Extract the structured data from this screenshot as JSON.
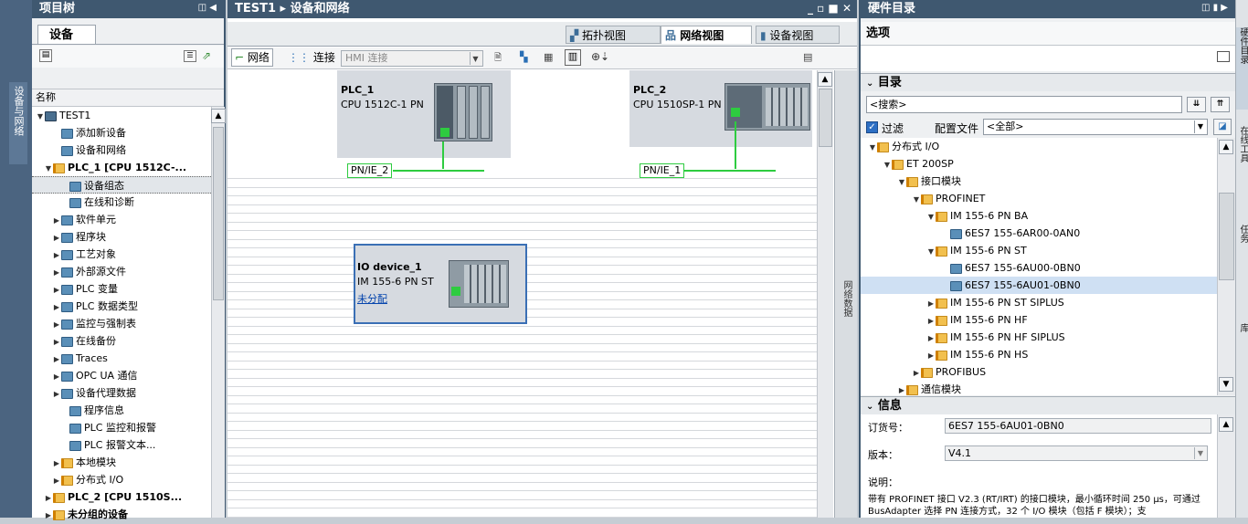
{
  "left_strip": {
    "label": "设备与网络"
  },
  "project_tree": {
    "title": "项目树",
    "tab": "设备",
    "column_header": "名称",
    "items": [
      {
        "label": "TEST1",
        "indent": 0,
        "arrow": "▼",
        "icon": "dev"
      },
      {
        "label": "添加新设备",
        "indent": 2,
        "arrow": "",
        "icon": "gicon"
      },
      {
        "label": "设备和网络",
        "indent": 2,
        "arrow": "",
        "icon": "gicon"
      },
      {
        "label": "PLC_1 [CPU 1512C-...",
        "indent": 1,
        "arrow": "▼",
        "icon": "fold"
      },
      {
        "label": "设备组态",
        "indent": 3,
        "arrow": "",
        "icon": "gicon"
      },
      {
        "label": "在线和诊断",
        "indent": 3,
        "arrow": "",
        "icon": "gicon"
      },
      {
        "label": "软件单元",
        "indent": 2,
        "arrow": "▶",
        "icon": "gicon"
      },
      {
        "label": "程序块",
        "indent": 2,
        "arrow": "▶",
        "icon": "gicon"
      },
      {
        "label": "工艺对象",
        "indent": 2,
        "arrow": "▶",
        "icon": "gicon"
      },
      {
        "label": "外部源文件",
        "indent": 2,
        "arrow": "▶",
        "icon": "gicon"
      },
      {
        "label": "PLC 变量",
        "indent": 2,
        "arrow": "▶",
        "icon": "gicon"
      },
      {
        "label": "PLC 数据类型",
        "indent": 2,
        "arrow": "▶",
        "icon": "gicon"
      },
      {
        "label": "监控与强制表",
        "indent": 2,
        "arrow": "▶",
        "icon": "gicon"
      },
      {
        "label": "在线备份",
        "indent": 2,
        "arrow": "▶",
        "icon": "gicon"
      },
      {
        "label": "Traces",
        "indent": 2,
        "arrow": "▶",
        "icon": "gicon"
      },
      {
        "label": "OPC UA 通信",
        "indent": 2,
        "arrow": "▶",
        "icon": "gicon"
      },
      {
        "label": "设备代理数据",
        "indent": 2,
        "arrow": "▶",
        "icon": "gicon"
      },
      {
        "label": "程序信息",
        "indent": 3,
        "arrow": "",
        "icon": "gicon"
      },
      {
        "label": "PLC 监控和报警",
        "indent": 3,
        "arrow": "",
        "icon": "gicon"
      },
      {
        "label": "PLC 报警文本...",
        "indent": 3,
        "arrow": "",
        "icon": "gicon"
      },
      {
        "label": "本地模块",
        "indent": 2,
        "arrow": "▶",
        "icon": "fold"
      },
      {
        "label": "分布式 I/O",
        "indent": 2,
        "arrow": "▶",
        "icon": "fold"
      },
      {
        "label": "PLC_2 [CPU 1510S...",
        "indent": 1,
        "arrow": "▶",
        "icon": "fold"
      },
      {
        "label": "未分组的设备",
        "indent": 1,
        "arrow": "▶",
        "icon": "fold"
      }
    ]
  },
  "editor": {
    "title": "TEST1 ▸ 设备和网络",
    "views": {
      "topology": "拓扑视图",
      "network": "网络视图",
      "device": "设备视图"
    },
    "toolbar": {
      "network": "网络",
      "connection": "连接",
      "hmi_connection": "HMI 连接"
    },
    "devices": {
      "plc1": {
        "name": "PLC_1",
        "cpu": "CPU 1512C-1 PN",
        "net": "PN/IE_2"
      },
      "plc2": {
        "name": "PLC_2",
        "cpu": "CPU 1510SP-1 PN",
        "net": "PN/IE_1"
      },
      "io": {
        "name": "IO device_1",
        "module": "IM 155-6 PN ST",
        "status": "未分配"
      }
    },
    "side_tab": "网络数据"
  },
  "catalog": {
    "title": "硬件目录",
    "options": "选项",
    "section_catalog": "目录",
    "search_placeholder": "<搜索>",
    "filter_label": "过滤",
    "profile_label": "配置文件",
    "profile_value": "<全部>",
    "items": [
      {
        "label": "分布式 I/O",
        "indent": 0,
        "arrow": "▼",
        "icon": "fold"
      },
      {
        "label": "ET 200SP",
        "indent": 1,
        "arrow": "▼",
        "icon": "fold"
      },
      {
        "label": "接口模块",
        "indent": 2,
        "arrow": "▼",
        "icon": "fold"
      },
      {
        "label": "PROFINET",
        "indent": 3,
        "arrow": "▼",
        "icon": "fold"
      },
      {
        "label": "IM 155-6 PN BA",
        "indent": 4,
        "arrow": "▼",
        "icon": "fold"
      },
      {
        "label": "6ES7 155-6AR00-0AN0",
        "indent": 5,
        "arrow": "",
        "icon": "gicon"
      },
      {
        "label": "IM 155-6 PN ST",
        "indent": 4,
        "arrow": "▼",
        "icon": "fold"
      },
      {
        "label": "6ES7 155-6AU00-0BN0",
        "indent": 5,
        "arrow": "",
        "icon": "gicon"
      },
      {
        "label": "6ES7 155-6AU01-0BN0",
        "indent": 5,
        "arrow": "",
        "icon": "gicon",
        "selected": true
      },
      {
        "label": "IM 155-6 PN ST SIPLUS",
        "indent": 4,
        "arrow": "▶",
        "icon": "fold"
      },
      {
        "label": "IM 155-6 PN HF",
        "indent": 4,
        "arrow": "▶",
        "icon": "fold"
      },
      {
        "label": "IM 155-6 PN HF SIPLUS",
        "indent": 4,
        "arrow": "▶",
        "icon": "fold"
      },
      {
        "label": "IM 155-6 PN HS",
        "indent": 4,
        "arrow": "▶",
        "icon": "fold"
      },
      {
        "label": "PROFIBUS",
        "indent": 3,
        "arrow": "▶",
        "icon": "fold"
      },
      {
        "label": "通信模块",
        "indent": 2,
        "arrow": "▶",
        "icon": "fold"
      }
    ],
    "info": {
      "section_title": "信息",
      "order_label": "订货号：",
      "order_value": "6ES7 155-6AU01-0BN0",
      "version_label": "版本：",
      "version_value": "V4.1",
      "desc_label": "说明：",
      "desc_text": "带有 PROFINET 接口 V2.3 (RT/IRT) 的接口模块，最小循环时间 250 μs，可通过 BusAdapter 选择 PN 连接方式，32 个 I/O 模块（包括 F 模块）；支"
    }
  },
  "right_strip": {
    "tabs": [
      "硬件目录",
      "在线工具",
      "任务",
      "库"
    ]
  }
}
